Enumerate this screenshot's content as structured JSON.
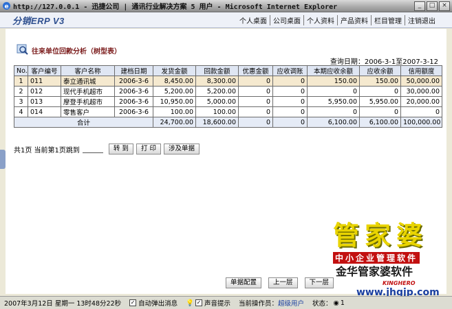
{
  "window": {
    "title": "http://127.0.0.1 - 迅捷公司  | 通讯行业解决方案 5 用户 - Microsoft Internet Explorer",
    "buttons": [
      "_",
      "□",
      "×"
    ]
  },
  "app": {
    "logo": "分销ERP V3",
    "nav": [
      "个人桌面",
      "公司桌面",
      "个人资料",
      "产品资料",
      "栏目管理",
      "注销退出"
    ]
  },
  "page": {
    "heading": "往来单位回款分析（树型表）",
    "query_date": "查询日期：2006-3-1至2007-3-12"
  },
  "table": {
    "headers": [
      "No.",
      "客户编号",
      "客户名称",
      "建档日期",
      "发货金额",
      "回款金额",
      "优惠金额",
      "应收调账",
      "本期应收余额",
      "应收余额",
      "信用额度"
    ],
    "rows": [
      [
        "1",
        "011",
        "泰立通讯城",
        "2006-3-6",
        "8,450.00",
        "8,300.00",
        "0",
        "0",
        "150.00",
        "150.00",
        "50,000.00"
      ],
      [
        "2",
        "012",
        "现代手机超市",
        "2006-3-6",
        "5,200.00",
        "5,200.00",
        "0",
        "0",
        "0",
        "0",
        "30,000.00"
      ],
      [
        "3",
        "013",
        "摩登手机超市",
        "2006-3-6",
        "10,950.00",
        "5,000.00",
        "0",
        "0",
        "5,950.00",
        "5,950.00",
        "20,000.00"
      ],
      [
        "4",
        "014",
        "零售客户",
        "2006-3-6",
        "100.00",
        "100.00",
        "0",
        "0",
        "0",
        "0",
        "0"
      ]
    ],
    "total": {
      "label": "合计",
      "values": [
        "24,700.00",
        "18,600.00",
        "0",
        "0",
        "6,100.00",
        "6,100.00",
        "100,000.00"
      ]
    }
  },
  "pager": {
    "text": "共1页 当前第1页跳到",
    "buttons": [
      "转 到",
      "打 印",
      "涉及单据"
    ]
  },
  "bottom_buttons": [
    "单据配置",
    "上一层",
    "下一层"
  ],
  "brand": {
    "name": "管家婆",
    "tagline": "中小企业管理软件",
    "company": "金华管家婆软件",
    "en": "KINGHERO",
    "url": "www.jhgjp.com"
  },
  "status": {
    "datetime": "2007年3月12日 星期一 13时48分22秒",
    "auto_popup": "自动弹出消息",
    "sound": "声音提示",
    "operator_label": "当前操作员：",
    "operator": "超级用户",
    "state_label": "状态：",
    "state_value": "1"
  }
}
